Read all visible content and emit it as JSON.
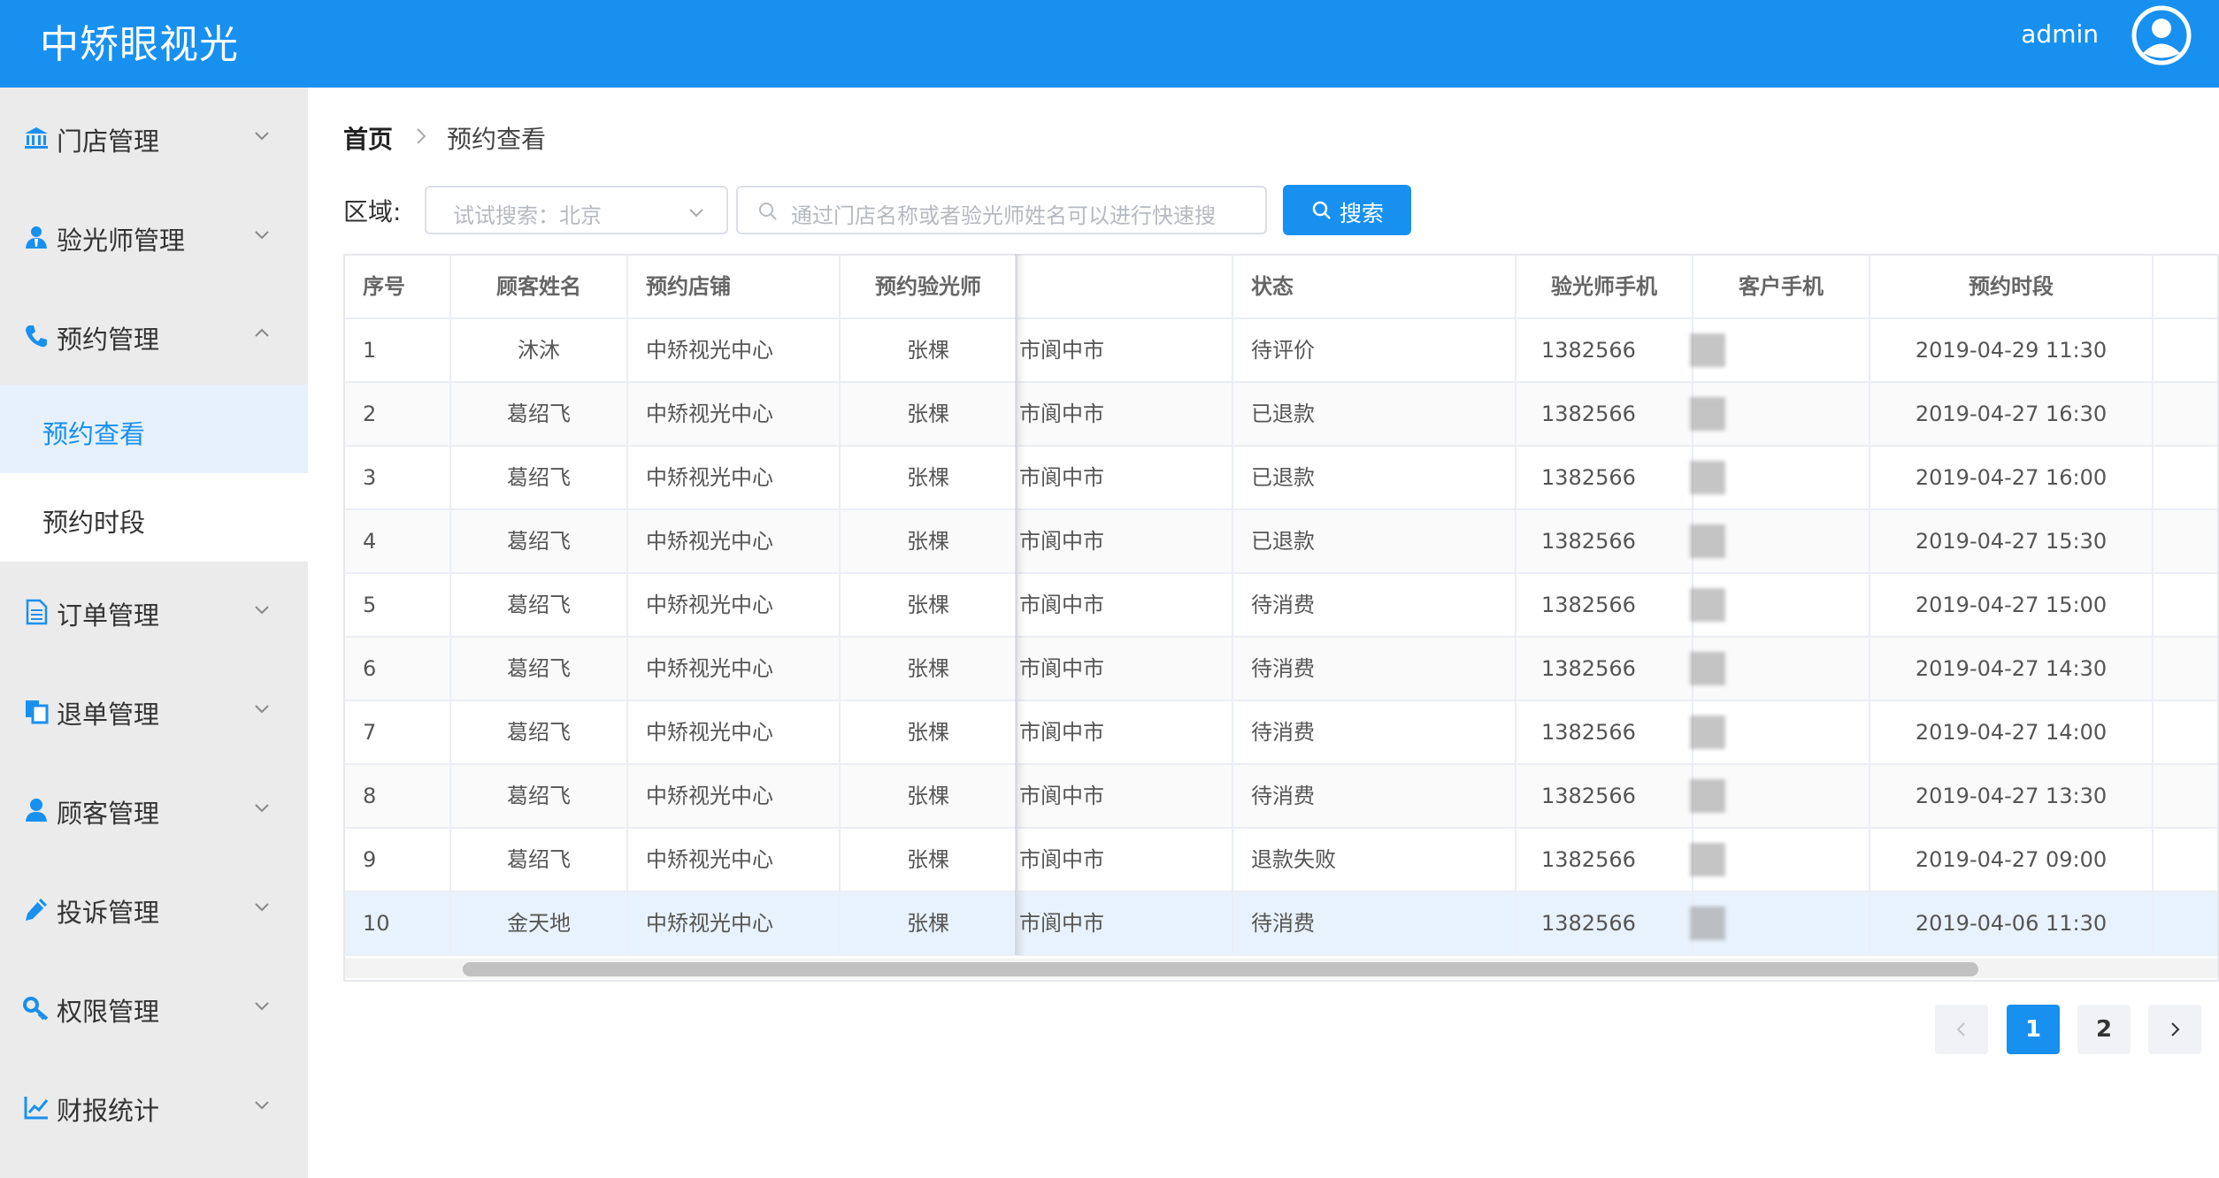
{
  "header": {
    "brand": "中矫眼视光",
    "user": "admin"
  },
  "sidebar": {
    "items": [
      {
        "label": "门店管理",
        "icon": "bank-icon"
      },
      {
        "label": "验光师管理",
        "icon": "user-tie-icon"
      },
      {
        "label": "预约管理",
        "icon": "phone-icon",
        "expanded": true,
        "children": [
          {
            "label": "预约查看",
            "active": true
          },
          {
            "label": "预约时段"
          }
        ]
      },
      {
        "label": "订单管理",
        "icon": "file-icon"
      },
      {
        "label": "退单管理",
        "icon": "copy-icon"
      },
      {
        "label": "顾客管理",
        "icon": "user-icon"
      },
      {
        "label": "投诉管理",
        "icon": "pencil-icon"
      },
      {
        "label": "权限管理",
        "icon": "key-icon"
      },
      {
        "label": "财报统计",
        "icon": "chart-line-icon"
      }
    ]
  },
  "breadcrumb": {
    "home": "首页",
    "current": "预约查看"
  },
  "filter": {
    "area_label": "区域:",
    "area_placeholder": "试试搜索：北京",
    "search_placeholder": "通过门店名称或者验光师姓名可以进行快速搜",
    "search_button": "搜索"
  },
  "table": {
    "columns": [
      "序号",
      "顾客姓名",
      "预约店铺",
      "预约验光师",
      "",
      "状态",
      "验光师手机",
      "客户手机",
      "预约时段"
    ],
    "rows": [
      [
        "1",
        "沐沐",
        "中矫视光中心",
        "张棵",
        "市阆中市",
        "待评价",
        "1382566",
        "",
        "2019-04-29 11:30"
      ],
      [
        "2",
        "葛绍飞",
        "中矫视光中心",
        "张棵",
        "市阆中市",
        "已退款",
        "1382566",
        "",
        "2019-04-27 16:30"
      ],
      [
        "3",
        "葛绍飞",
        "中矫视光中心",
        "张棵",
        "市阆中市",
        "已退款",
        "1382566",
        "",
        "2019-04-27 16:00"
      ],
      [
        "4",
        "葛绍飞",
        "中矫视光中心",
        "张棵",
        "市阆中市",
        "已退款",
        "1382566",
        "",
        "2019-04-27 15:30"
      ],
      [
        "5",
        "葛绍飞",
        "中矫视光中心",
        "张棵",
        "市阆中市",
        "待消费",
        "1382566",
        "",
        "2019-04-27 15:00"
      ],
      [
        "6",
        "葛绍飞",
        "中矫视光中心",
        "张棵",
        "市阆中市",
        "待消费",
        "1382566",
        "",
        "2019-04-27 14:30"
      ],
      [
        "7",
        "葛绍飞",
        "中矫视光中心",
        "张棵",
        "市阆中市",
        "待消费",
        "1382566",
        "",
        "2019-04-27 14:00"
      ],
      [
        "8",
        "葛绍飞",
        "中矫视光中心",
        "张棵",
        "市阆中市",
        "待消费",
        "1382566",
        "",
        "2019-04-27 13:30"
      ],
      [
        "9",
        "葛绍飞",
        "中矫视光中心",
        "张棵",
        "市阆中市",
        "退款失败",
        "1382566",
        "",
        "2019-04-27 09:00"
      ],
      [
        "10",
        "金天地",
        "中矫视光中心",
        "张棵",
        "市阆中市",
        "待消费",
        "1382566",
        "",
        "2019-04-06 11:30"
      ]
    ],
    "highlighted_row": 10
  },
  "pagination": {
    "pages": [
      "1",
      "2"
    ],
    "current": "1"
  },
  "colors": {
    "primary": "#1890f0",
    "sidebar_bg": "#ebebeb",
    "active_bg": "#e6f1fc"
  }
}
